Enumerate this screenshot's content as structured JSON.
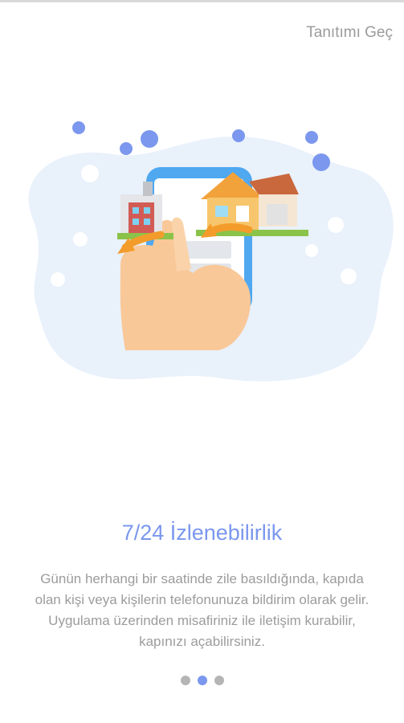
{
  "header": {
    "skip_label": "Tanıtımı Geç"
  },
  "illustration": {
    "icon": "doorbell-phone-illustration"
  },
  "content": {
    "title": "7/24 İzlenebilirlik",
    "description": "Günün herhangi bir saatinde zile basıldığında, kapıda\nolan kişi veya kişilerin telefonunuza bildirim olarak gelir.\nUygulama üzerinden misafiriniz ile iletişim kurabilir,\nkapınızı açabilirsiniz."
  },
  "pager": {
    "total": 3,
    "active_index": 1
  },
  "colors": {
    "accent": "#7b97ee",
    "muted_text": "#9c9c9c",
    "skip_text": "#9b9b9b",
    "inactive_dot": "#b5b5b5"
  }
}
